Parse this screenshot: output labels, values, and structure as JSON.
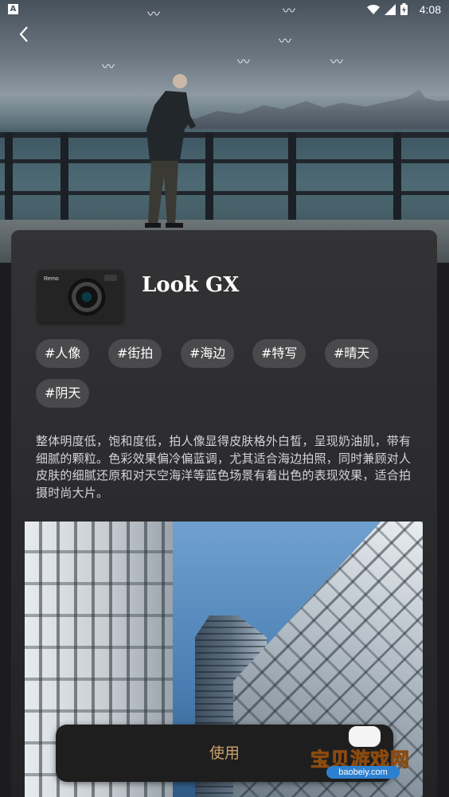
{
  "status_bar": {
    "time": "4:08",
    "app_icon_letter": "A"
  },
  "icons": {
    "back": "chevron-left-icon",
    "wifi": "wifi-icon",
    "signal": "signal-icon",
    "battery": "battery-icon"
  },
  "filter": {
    "title": "Look GX",
    "camera_brand": "Remo",
    "tags": [
      "#人像",
      "#街拍",
      "#海边",
      "#特写",
      "#晴天",
      "#阴天"
    ],
    "description": "整体明度低，饱和度低，拍人像显得皮肤格外白皙，呈现奶油肌，带有细腻的颗粒。色彩效果偏冷偏蓝调，尤其适合海边拍照，同时兼顾对人皮肤的细腻还原和对天空海洋等蓝色场景有着出色的表现效果，适合拍摄时尚大片。"
  },
  "actions": {
    "use_label": "使用"
  },
  "watermark": {
    "name": "宝贝游戏网",
    "url": "baobeiy.com"
  },
  "colors": {
    "accent": "#c9a06a",
    "card": "#2f2f31",
    "tag_bg": "#4a4a4c"
  }
}
